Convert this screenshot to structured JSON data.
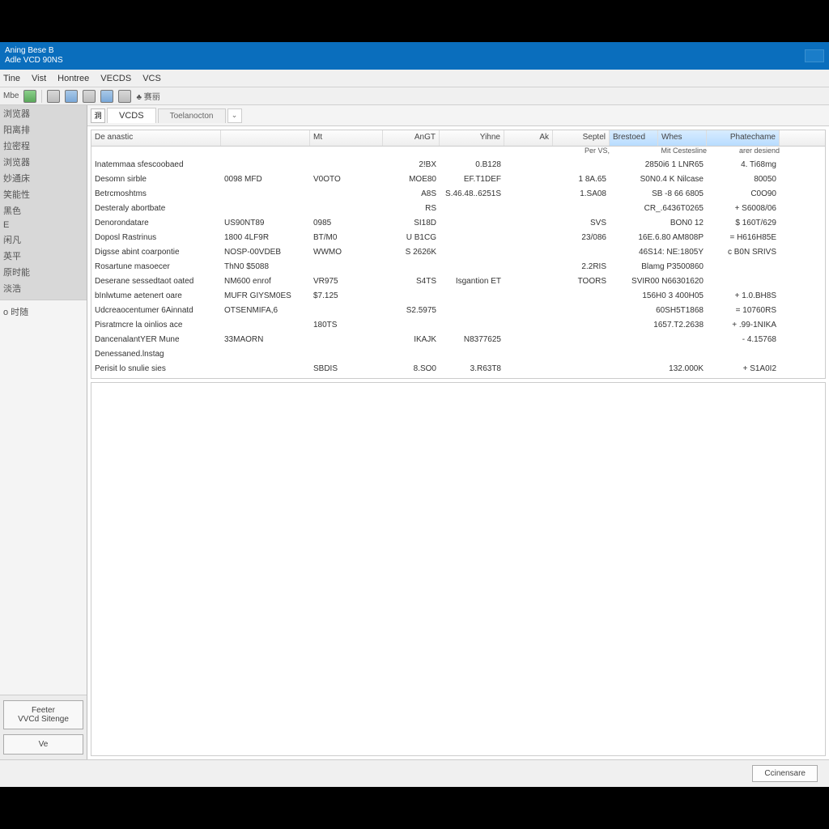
{
  "title": {
    "line1": "Aning Bese B",
    "line2": "Adle VCD 90NS"
  },
  "menubar": [
    "Tine",
    "Vist",
    "Hontree",
    "VECDS",
    "VCS"
  ],
  "toolbar": {
    "label": "Mbe"
  },
  "sidebar": {
    "items": [
      "浏览器",
      "阳离排",
      "拉密程",
      "浏览器",
      "妙通床",
      "笑能性",
      "黑色",
      "E",
      "闲凡",
      "英平",
      "原时能",
      "淡浩"
    ],
    "lower_item": "o 时随",
    "buttons": {
      "settings": "Feeter\nVVCd Sitenge",
      "ve": "Ve"
    }
  },
  "tabs": {
    "icon": "洞",
    "main": "VCDS",
    "second": "Toelanocton"
  },
  "grid": {
    "headers": [
      "De anastic",
      "",
      "Mt",
      "AnGT",
      "Yihne",
      "Ak",
      "Septel",
      "Brestoed",
      "Whes",
      "Phatechame"
    ],
    "subheaders": [
      "",
      "",
      "",
      "",
      "",
      "",
      "Per VS,",
      "Mit Cestesline",
      "",
      "arer desiend"
    ],
    "rows": [
      {
        "c0": "Inatemmaa sfescoobaed",
        "c1": "",
        "c2": "",
        "c3": "2!BX",
        "c4": "0.B128",
        "c5": "",
        "c6": "",
        "c7": "2850i6 1 LNR65",
        "c8": "4. Ti68mg"
      },
      {
        "c0": "Desomn sirble",
        "c1": "0098 MFD",
        "c2": "V0OTO",
        "c3": "MOE80",
        "c4": "EF.T1DEF",
        "c5": "",
        "c6": "1 8A.65",
        "c7": "S0N0.4 K Nilcase",
        "c8": "80050"
      },
      {
        "c0": "Betrcmoshtms",
        "c1": "",
        "c2": "",
        "c3": "A8S",
        "c4": "S.46.48..6251S",
        "c5": "",
        "c6": "1.SA08",
        "c7": "SB -8 66 6805",
        "c8": "C0O90"
      },
      {
        "c0": "Desteraly abortbate",
        "c1": "",
        "c2": "",
        "c3": "RS",
        "c4": "",
        "c5": "",
        "c6": "",
        "c7": "CR_.6436T0265",
        "c8": "+ S6008/06"
      },
      {
        "c0": "Denorondatare",
        "c1": "US90NT89",
        "c2": "0985",
        "c3": "SI18D",
        "c4": "",
        "c5": "",
        "c6": "SVS",
        "c7": "BON0 12",
        "c8": "$ 160T/629"
      },
      {
        "c0": "Doposl Rastrinus",
        "c1": "1800 4LF9R",
        "c2": "BT/M0",
        "c3": "U B1CG",
        "c4": "",
        "c5": "",
        "c6": "23/086",
        "c7": "16E.6.80 AM808P",
        "c8": "= H616H85E"
      },
      {
        "c0": "Digsse abint coarpontie",
        "c1": "NOSP-00VDEB",
        "c2": "WWMO",
        "c3": "S 2626K",
        "c4": "",
        "c5": "",
        "c6": "",
        "c7": "46S14: NE:1805Y",
        "c8": "c B0N SRIVS"
      },
      {
        "c0": "Rosartune masoecer",
        "c1": "ThN0 $5088",
        "c2": "",
        "c3": "",
        "c4": "",
        "c5": "",
        "c6": "2.2RIS",
        "c7": "Blamg P3500860",
        "c8": ""
      },
      {
        "c0": "Deserane sessedtaot oated",
        "c1": "NM600 enrof",
        "c2": "VR975",
        "c3": "S4TS",
        "c4": "Isgantion ET",
        "c5": "",
        "c6": "TOORS",
        "c7": "SVIR00 N66301620",
        "c8": ""
      },
      {
        "c0": "bInlwtume aetenert oare",
        "c1": "MUFR GIYSM0ES",
        "c2": "$7.125",
        "c3": "",
        "c4": "",
        "c5": "",
        "c6": "",
        "c7": "156H0 3 400H05",
        "c8": "+ 1.0.BH8S"
      },
      {
        "c0": "Udcreaocentumer 6Ainnatd",
        "c1": "OTSENMIFA,6",
        "c2": "",
        "c3": "S2.5975",
        "c4": "",
        "c5": "",
        "c6": "",
        "c7": "60SH5T1868",
        "c8": "= 10760RS"
      },
      {
        "c0": "Pisratmcre la oinlios ace",
        "c1": "",
        "c2": "180TS",
        "c3": "",
        "c4": "",
        "c5": "",
        "c6": "",
        "c7": "1657.T2.2638",
        "c8": "+ .99-1NIKA"
      },
      {
        "c0": "DancenalantYER Mune",
        "c1": "33MAORN",
        "c2": "",
        "c3": "IKAJK",
        "c4": "N8377625",
        "c5": "",
        "c6": "",
        "c7": "",
        "c8": "- 4.15768"
      },
      {
        "c0": "Denessaned.lnstag",
        "c1": "",
        "c2": "",
        "c3": "",
        "c4": "",
        "c5": "",
        "c6": "",
        "c7": "",
        "c8": ""
      },
      {
        "c0": "Perisit lo snulie sies",
        "c1": "",
        "c2": "SBDIS",
        "c3": "8.SO0",
        "c4": "3.R63T8",
        "c5": "",
        "c6": "",
        "c7": "132.000K",
        "c8": "+ S1A0I2"
      }
    ]
  },
  "footer": {
    "button": "Ccinensare"
  }
}
